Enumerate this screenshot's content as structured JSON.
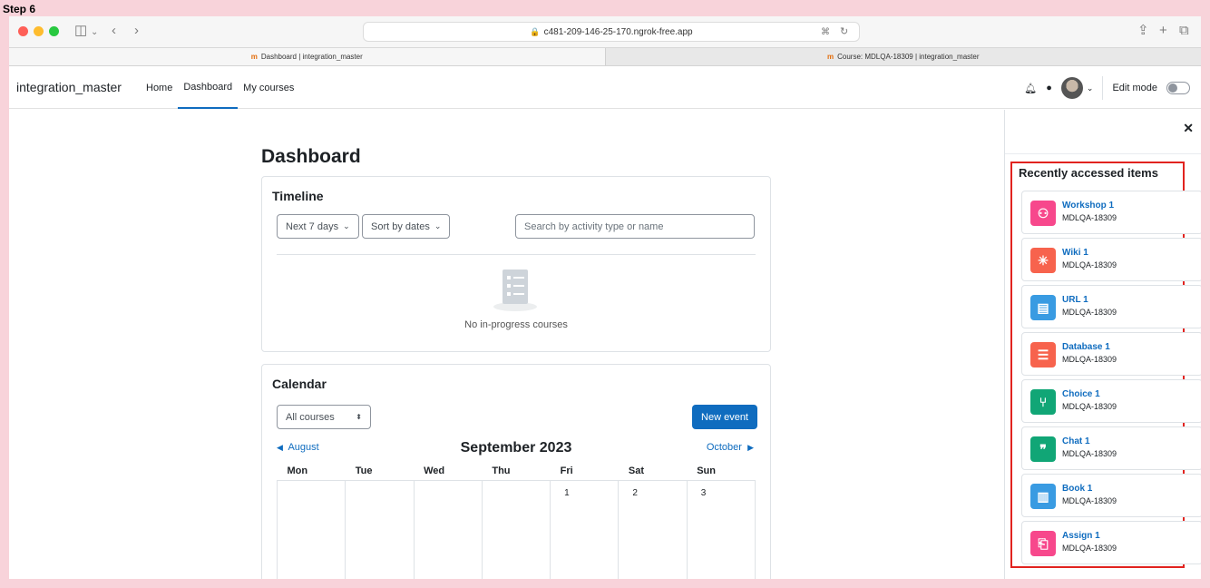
{
  "step_label": "Step 6",
  "browser": {
    "url": "c481-209-146-25-170.ngrok-free.app",
    "tabs": [
      {
        "label": "Dashboard | integration_master"
      },
      {
        "label": "Course: MDLQA-18309 | integration_master"
      }
    ]
  },
  "navbar": {
    "site_name": "integration_master",
    "links": [
      "Home",
      "Dashboard",
      "My courses"
    ],
    "edit_mode_label": "Edit mode"
  },
  "dashboard": {
    "title": "Dashboard",
    "timeline": {
      "title": "Timeline",
      "range_filter": "Next 7 days",
      "sort_filter": "Sort by dates",
      "search_placeholder": "Search by activity type or name",
      "empty_text": "No in-progress courses"
    },
    "calendar": {
      "title": "Calendar",
      "course_filter": "All courses",
      "new_event_label": "New event",
      "prev_month": "August",
      "next_month": "October",
      "month_title": "September 2023",
      "weekdays": [
        "Mon",
        "Tue",
        "Wed",
        "Thu",
        "Fri",
        "Sat",
        "Sun"
      ],
      "first_row": [
        "",
        "",
        "",
        "",
        "1",
        "2",
        "3"
      ]
    }
  },
  "drawer": {
    "title": "Recently accessed items",
    "items": [
      {
        "name": "Workshop 1",
        "course": "MDLQA-18309",
        "icon": "workshop-icon",
        "color": "#f7488c"
      },
      {
        "name": "Wiki 1",
        "course": "MDLQA-18309",
        "icon": "wiki-icon",
        "color": "#f7634d"
      },
      {
        "name": "URL 1",
        "course": "MDLQA-18309",
        "icon": "url-icon",
        "color": "#399be2"
      },
      {
        "name": "Database 1",
        "course": "MDLQA-18309",
        "icon": "database-icon",
        "color": "#f7634d"
      },
      {
        "name": "Choice 1",
        "course": "MDLQA-18309",
        "icon": "choice-icon",
        "color": "#11a676"
      },
      {
        "name": "Chat 1",
        "course": "MDLQA-18309",
        "icon": "chat-icon",
        "color": "#11a676"
      },
      {
        "name": "Book 1",
        "course": "MDLQA-18309",
        "icon": "book-icon",
        "color": "#399be2"
      },
      {
        "name": "Assign 1",
        "course": "MDLQA-18309",
        "icon": "assign-icon",
        "color": "#f7488c"
      }
    ]
  }
}
